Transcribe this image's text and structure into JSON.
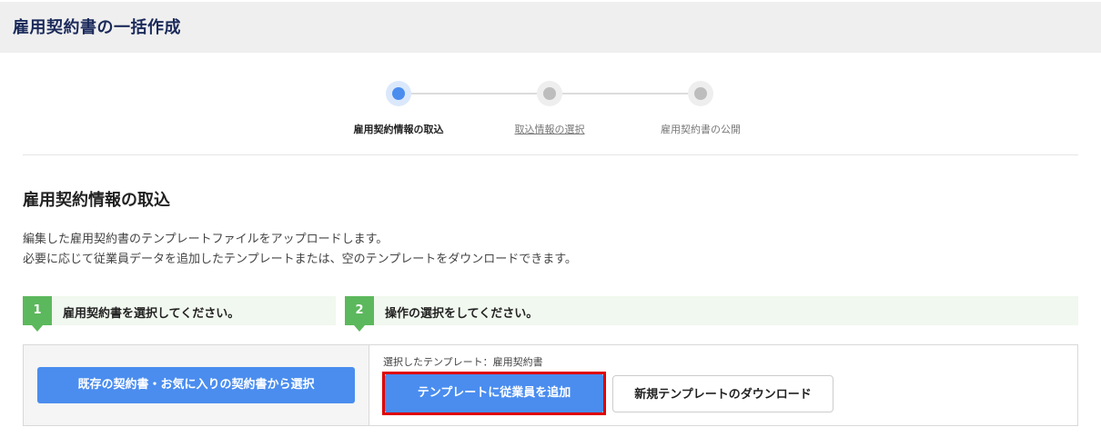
{
  "header": {
    "title": "雇用契約書の一括作成"
  },
  "stepper": {
    "steps": [
      {
        "label": "雇用契約情報の取込",
        "state": "active"
      },
      {
        "label": "取込情報の選択",
        "state": "link"
      },
      {
        "label": "雇用契約書の公開",
        "state": "inactive"
      }
    ]
  },
  "section": {
    "title": "雇用契約情報の取込",
    "desc_line1": "編集した雇用契約書のテンプレートファイルをアップロードします。",
    "desc_line2": "必要に応じて従業員データを追加したテンプレートまたは、空のテンプレートをダウンロードできます。"
  },
  "instructions": [
    {
      "num": "1",
      "text": "雇用契約書を選択してください。"
    },
    {
      "num": "2",
      "text": "操作の選択をしてください。"
    }
  ],
  "actions": {
    "select_button": "既存の契約書・お気に入りの契約書から選択",
    "selected_template": "選択したテンプレート：雇用契約書",
    "add_employees_button": "テンプレートに従業員を追加",
    "download_button": "新規テンプレートのダウンロード"
  },
  "colors": {
    "accent": "#4a8def",
    "step_green": "#5cb85c",
    "highlight_red": "#e00000",
    "header_bg": "#efefef"
  }
}
